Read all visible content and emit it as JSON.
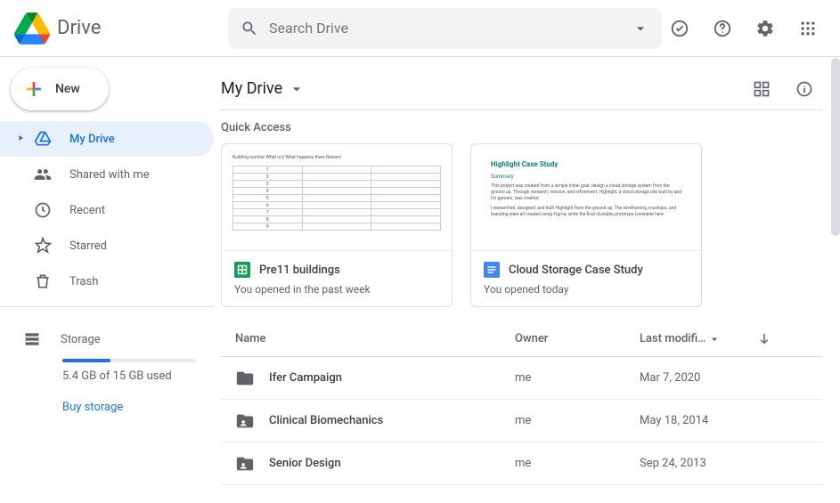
{
  "header": {
    "app_name": "Drive",
    "search_placeholder": "Search Drive"
  },
  "sidebar": {
    "new_label": "New",
    "items": [
      {
        "label": "My Drive"
      },
      {
        "label": "Shared with me"
      },
      {
        "label": "Recent"
      },
      {
        "label": "Starred"
      },
      {
        "label": "Trash"
      }
    ],
    "storage_label": "Storage",
    "storage_text": "5.4 GB of 15 GB used",
    "buy_link": "Buy storage"
  },
  "main": {
    "breadcrumb": "My Drive",
    "quick_access_title": "Quick Access",
    "quick_access": [
      {
        "name": "Pre11 buildings",
        "subtitle": "You opened in the past week",
        "type": "sheets"
      },
      {
        "name": "Cloud Storage Case Study",
        "subtitle": "You opened today",
        "type": "docs"
      }
    ],
    "columns": {
      "name": "Name",
      "owner": "Owner",
      "modified": "Last modifi…"
    },
    "files": [
      {
        "name": "Ifer Campaign",
        "owner": "me",
        "modified": "Mar 7, 2020",
        "type": "folder"
      },
      {
        "name": "Clinical Biomechanics",
        "owner": "me",
        "modified": "May 18, 2014",
        "type": "shared-folder"
      },
      {
        "name": "Senior Design",
        "owner": "me",
        "modified": "Sep 24, 2013",
        "type": "shared-folder"
      }
    ],
    "preview_doc": {
      "title": "Highlight Case Study",
      "subtitle": "Summary",
      "body1": "This project was created from a simple initial goal: design a cloud storage system from the ground up. Through research, revision, and refinement, Highlight, a cloud storage site built by and for gamers, was created.",
      "body2": "I researched, designed, and built Highlight from the ground up. The wireframing, mockups, and branding were all created using Figma, while the final clickable prototype (viewable here"
    },
    "preview_sheet_header": "Building number  What is it   What happens there  Reward"
  }
}
